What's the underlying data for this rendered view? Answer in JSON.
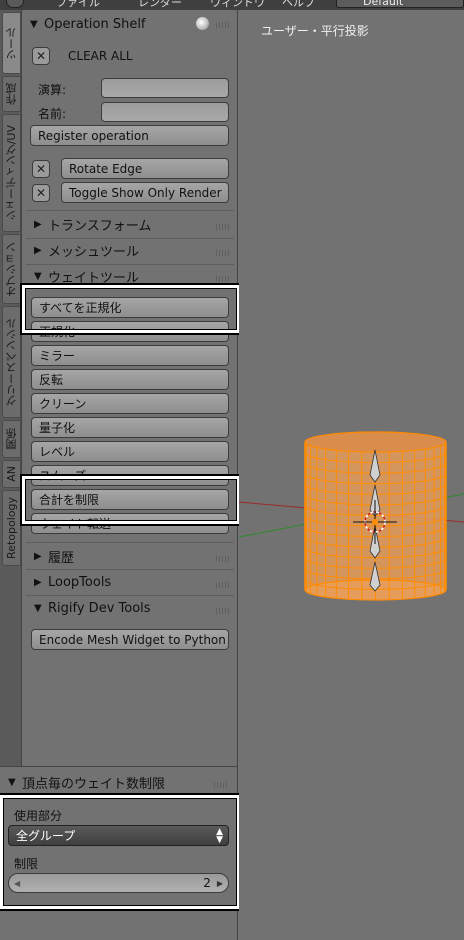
{
  "menubar": {
    "items": [
      "ファイル",
      "レンダー",
      "ウィンドウ",
      "ヘルプ"
    ],
    "screen_layout": "Default"
  },
  "tabs": [
    "ツール",
    "作成",
    "シェーディング/UV",
    "オプション",
    "グリースペンシル",
    "関係",
    "AN",
    "Retopology"
  ],
  "operation_shelf": {
    "title": "Operation Shelf",
    "clear_all": "CLEAR ALL",
    "calc_label": "演算:",
    "calc_value": "",
    "name_label": "名前:",
    "name_value": "",
    "register_label": "Register operation",
    "ops": [
      "Rotate Edge",
      "Toggle Show Only Render"
    ]
  },
  "panels": {
    "transform": "トランスフォーム",
    "meshtools": "メッシュツール",
    "weighttools": "ウェイトツール",
    "history": "履歴",
    "looptools": "LoopTools",
    "rigify": "Rigify Dev Tools"
  },
  "weight_buttons": [
    "すべてを正規化",
    "正規化",
    "ミラー",
    "反転",
    "クリーン",
    "量子化",
    "レベル",
    "スムーズ",
    "合計を制限",
    "ウェイト転送"
  ],
  "rigify": {
    "encode_label": "Encode Mesh Widget to Python"
  },
  "operator_panel": {
    "title": "頂点毎のウェイト数制限",
    "subset_label": "使用部分",
    "subset_value": "全グループ",
    "limit_label": "制限",
    "limit_value": "2"
  },
  "viewport": {
    "title": "ユーザー・平行投影"
  },
  "colors": {
    "mesh_wire": "#f08a00",
    "mesh_face": "#ffb347",
    "bg": "#727272",
    "axis_x": "#9a2a2a",
    "axis_y": "#2a8a2a"
  }
}
